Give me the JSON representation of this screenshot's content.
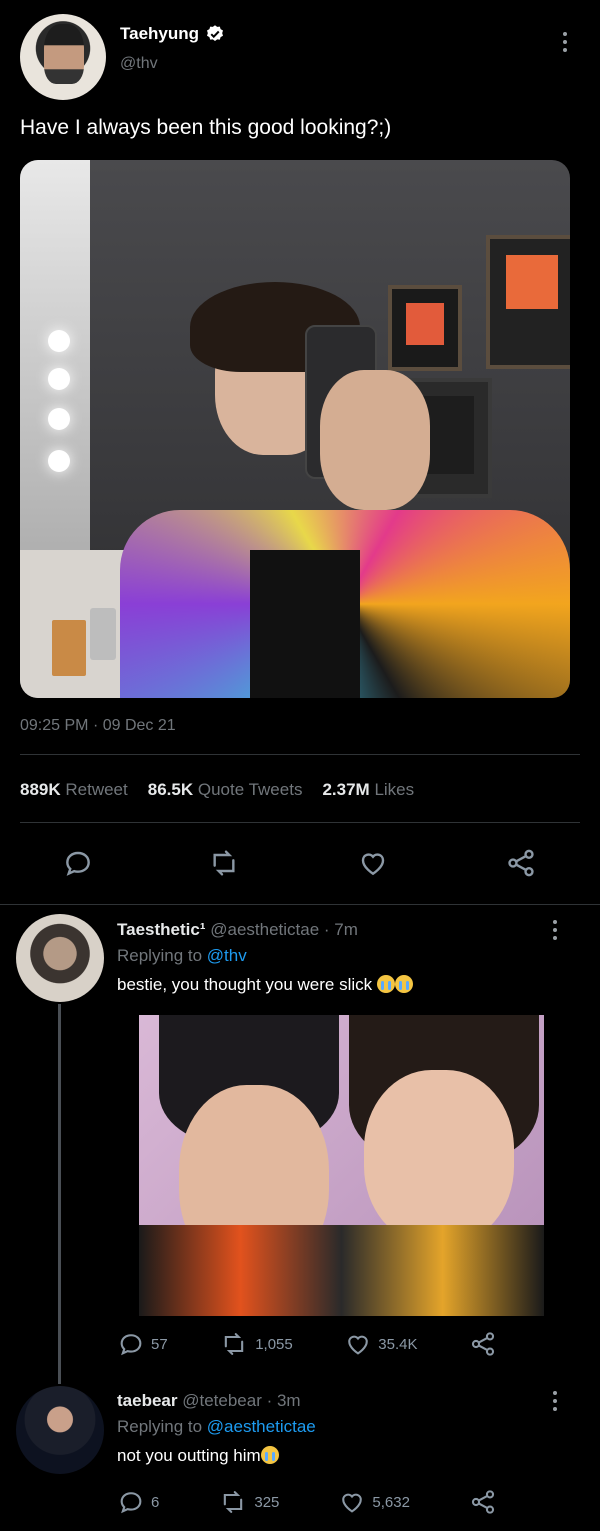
{
  "main_tweet": {
    "display_name": "Taehyung",
    "handle": "@thv",
    "verified_icon": "verified-badge-icon",
    "text": "Have I always been this good looking?;)",
    "time": "09:25 PM",
    "separator": "·",
    "date": "09 Dec 21",
    "stats": {
      "retweets": "889K",
      "retweets_label": "Retweet",
      "quotes": "86.5K",
      "quotes_label": "Quote Tweets",
      "likes": "2.37M",
      "likes_label": "Likes"
    }
  },
  "replies": [
    {
      "display_name": "Taesthetic¹",
      "handle": "@aesthetictae",
      "age": "· 7m",
      "replying_prefix": "Replying to",
      "replying_to": "@thv",
      "text": "bestie, you thought you were slick",
      "emoji": "loudly-crying-face-emoji",
      "stats": {
        "replies": "57",
        "retweets": "1,055",
        "likes": "35.4K"
      }
    },
    {
      "display_name": "taebear",
      "handle": "@tetebear",
      "age": "· 3m",
      "replying_prefix": "Replying to",
      "replying_to": "@aesthetictae",
      "text": "not you outting him",
      "emoji": "loudly-crying-face-emoji",
      "stats": {
        "replies": "6",
        "retweets": "325",
        "likes": "5,632"
      }
    }
  ],
  "colors": {
    "background": "#000000",
    "link": "#1d9bf0",
    "muted": "#71767b",
    "divider": "#2f3336"
  }
}
